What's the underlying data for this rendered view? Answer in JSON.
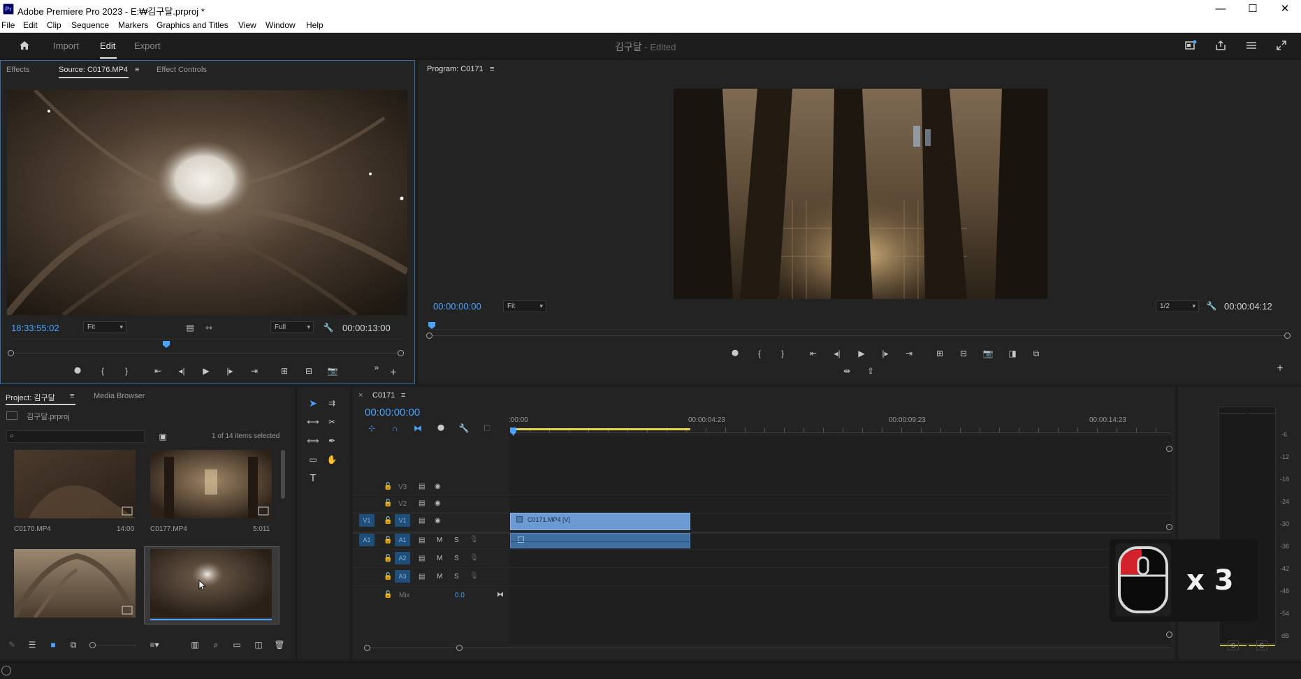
{
  "window": {
    "title": "Adobe Premiere Pro 2023 - E:₩김구달.prproj *",
    "logo": "Pr",
    "controls": [
      "minimize-icon",
      "maximize-icon",
      "close-icon"
    ]
  },
  "menu": [
    "File",
    "Edit",
    "Clip",
    "Sequence",
    "Markers",
    "Graphics and Titles",
    "View",
    "Window",
    "Help"
  ],
  "header": {
    "tabs": [
      "Import",
      "Edit",
      "Export"
    ],
    "active_tab": "Edit",
    "project_title": "김구달",
    "edited_label": "- Edited"
  },
  "source_monitor": {
    "tabs": [
      "Effects",
      "Source: C0176.MP4",
      "Effect Controls"
    ],
    "timecode_left": "18:33:55:02",
    "fit_option": "Fit",
    "quality_option": "Full",
    "duration": "00:00:13:00"
  },
  "program_monitor": {
    "tab": "Program: C0171",
    "timecode_left": "00:00:00:00",
    "fit_option": "Fit",
    "resolution_option": "1/2",
    "duration": "00:00:04:12"
  },
  "project_panel": {
    "tabs": [
      "Project: 김구달",
      "Media Browser"
    ],
    "project_file": "김구달.prproj",
    "search_placeholder": "",
    "selection_status": "1 of 14 items selected",
    "items": [
      {
        "name": "C0170.MP4",
        "duration": "14:00"
      },
      {
        "name": "C0177.MP4",
        "duration": "5:011"
      },
      {
        "name": "",
        "duration": ""
      },
      {
        "name": "",
        "duration": ""
      }
    ]
  },
  "timeline": {
    "sequence_tab": "C0171",
    "timecode": "00:00:00:00",
    "ruler_labels": [
      ":00:00",
      "00:00:04:23",
      "00:00:09:23",
      "00:00:14:23"
    ],
    "tracks": {
      "video": [
        "V3",
        "V2",
        "V1"
      ],
      "audio": [
        "A1",
        "A2",
        "A3"
      ],
      "source_v": "V1",
      "source_a": "A1",
      "m_label": "M",
      "s_label": "S"
    },
    "mix_label": "Mix",
    "mix_value": "0.0",
    "clip_video_label": "C0171.MP4 [V]"
  },
  "audio_meter": {
    "labels": [
      "-6",
      "-12",
      "-18",
      "-24",
      "-30",
      "-36",
      "-42",
      "-48",
      "-54",
      "dB"
    ],
    "solo_buttons": [
      "S",
      "S"
    ]
  },
  "click_overlay": {
    "count_label": "x 3"
  },
  "colors": {
    "accent_blue": "#4aa3ff",
    "clip_video": "#6b9bd2",
    "clip_audio": "#3f6ea0",
    "playhead_yellow": "#e8d44a"
  }
}
